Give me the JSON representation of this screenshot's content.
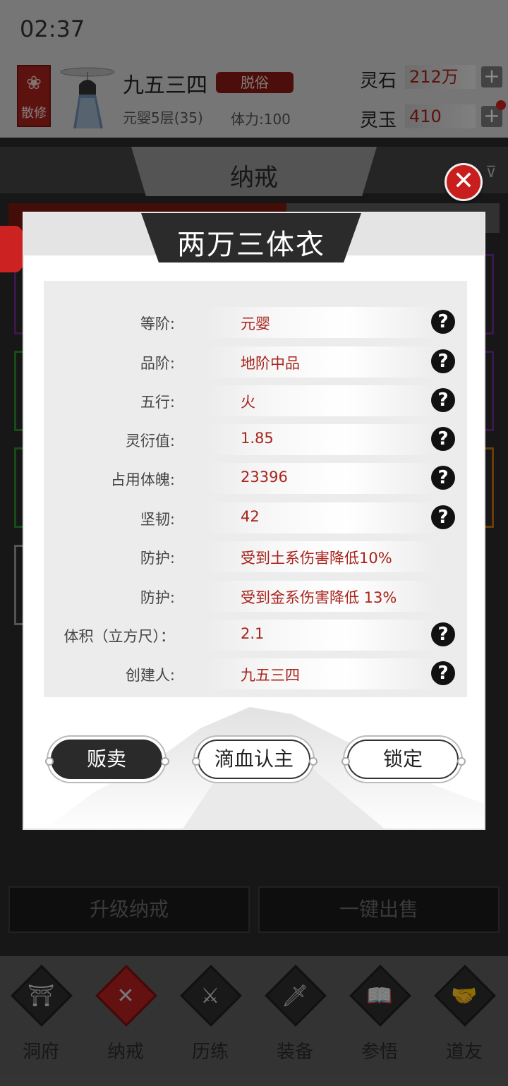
{
  "status_bar": {
    "time": "02:37"
  },
  "player": {
    "sect": "散修",
    "name": "九五三四",
    "title_tag": "脱俗",
    "realm": "元婴5层(35)",
    "stamina": "体力:100"
  },
  "currency": [
    {
      "label": "灵石",
      "value": "212万"
    },
    {
      "label": "灵玉",
      "value": "410"
    }
  ],
  "page": {
    "title": "纳戒"
  },
  "item": {
    "name": "两万三体衣",
    "attributes": [
      {
        "key": "等阶:",
        "value": "元婴",
        "help": true
      },
      {
        "key": "品阶:",
        "value": "地阶中品",
        "help": true
      },
      {
        "key": "五行:",
        "value": "火",
        "help": true
      },
      {
        "key": "灵衍值:",
        "value": "1.85",
        "help": true
      },
      {
        "key": "占用体魄:",
        "value": "23396",
        "help": true
      },
      {
        "key": "坚韧:",
        "value": "42",
        "help": true
      },
      {
        "key": "防护:",
        "value": "受到土系伤害降低10%",
        "help": false
      },
      {
        "key": "防护:",
        "value": "受到金系伤害降低 13%",
        "help": false
      },
      {
        "key": "体积（立方尺）：",
        "value": "2.1",
        "help": true
      },
      {
        "key": "创建人:",
        "value": "九五三四",
        "help": true
      }
    ],
    "help_glyph": "?",
    "actions": {
      "sell": "贩卖",
      "bind": "滴血认主",
      "lock": "锁定"
    }
  },
  "bottom_actions": {
    "upgrade": "升级纳戒",
    "sell_all": "一键出售"
  },
  "nav": [
    {
      "label": "洞府",
      "icon": "cave-icon",
      "glyph": "⛩"
    },
    {
      "label": "纳戒",
      "icon": "ring-icon",
      "glyph": "✕",
      "active": true
    },
    {
      "label": "历练",
      "icon": "swords-icon",
      "glyph": "⚔"
    },
    {
      "label": "装备",
      "icon": "dagger-icon",
      "glyph": "🗡"
    },
    {
      "label": "参悟",
      "icon": "book-icon",
      "glyph": "📖"
    },
    {
      "label": "道友",
      "icon": "friends-icon",
      "glyph": "🤝"
    }
  ],
  "colors": {
    "accent_red": "#a8231c",
    "close_red": "#c81e1e"
  }
}
